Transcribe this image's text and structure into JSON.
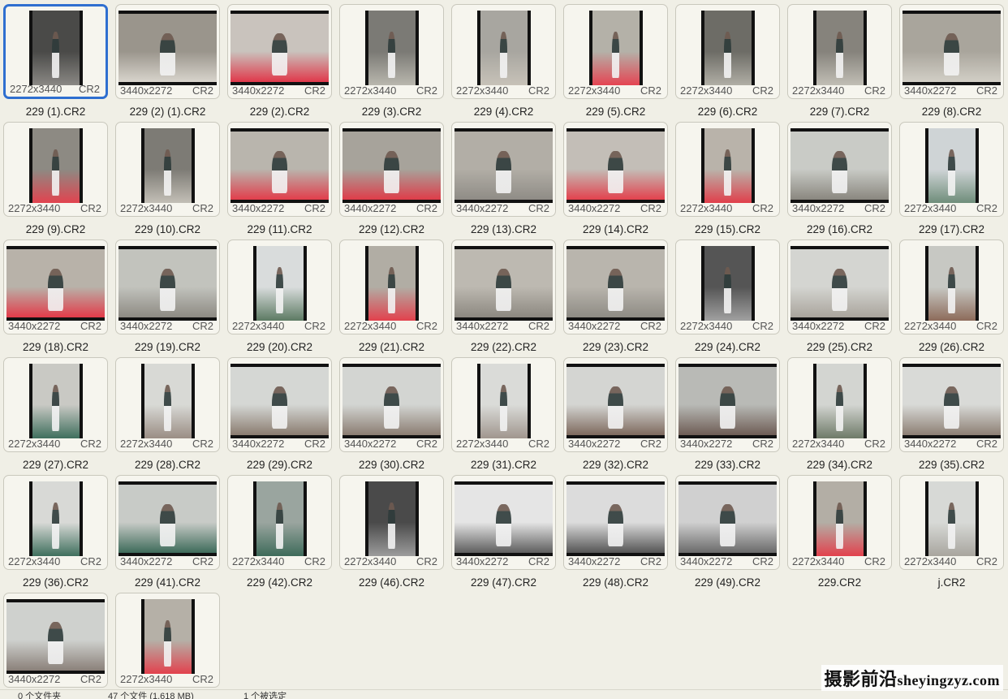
{
  "files": [
    {
      "name": "229 (1).CR2",
      "res": "2272x3440",
      "ext": "CR2",
      "selected": true,
      "tone": [
        "#4a4a48",
        "#8a8884"
      ]
    },
    {
      "name": "229 (2) (1).CR2",
      "res": "3440x2272",
      "ext": "CR2",
      "tone": [
        "#9a958c",
        "#d8d4cc"
      ]
    },
    {
      "name": "229 (2).CR2",
      "res": "3440x2272",
      "ext": "CR2",
      "tone": [
        "#c9c3bd",
        "#e0384a"
      ]
    },
    {
      "name": "229 (3).CR2",
      "res": "2272x3440",
      "ext": "CR2",
      "tone": [
        "#7b7a75",
        "#b9b7ae"
      ]
    },
    {
      "name": "229 (4).CR2",
      "res": "2272x3440",
      "ext": "CR2",
      "tone": [
        "#a8a6a0",
        "#c7c2b8"
      ]
    },
    {
      "name": "229 (5).CR2",
      "res": "2272x3440",
      "ext": "CR2",
      "tone": [
        "#b4b1a8",
        "#e54452"
      ]
    },
    {
      "name": "229 (6).CR2",
      "res": "2272x3440",
      "ext": "CR2",
      "tone": [
        "#6d6c66",
        "#b0aea5"
      ]
    },
    {
      "name": "229 (7).CR2",
      "res": "2272x3440",
      "ext": "CR2",
      "tone": [
        "#86837c",
        "#c1beb5"
      ]
    },
    {
      "name": "229 (8).CR2",
      "res": "3440x2272",
      "ext": "CR2",
      "tone": [
        "#a9a59c",
        "#d2cfc6"
      ]
    },
    {
      "name": "229 (9).CR2",
      "res": "2272x3440",
      "ext": "CR2",
      "tone": [
        "#8d8a83",
        "#e2434f"
      ]
    },
    {
      "name": "229 (10).CR2",
      "res": "2272x3440",
      "ext": "CR2",
      "tone": [
        "#7d7b75",
        "#c3bfb6"
      ]
    },
    {
      "name": "229 (11).CR2",
      "res": "3440x2272",
      "ext": "CR2",
      "tone": [
        "#b9b5ad",
        "#e23d4b"
      ]
    },
    {
      "name": "229 (12).CR2",
      "res": "3440x2272",
      "ext": "CR2",
      "tone": [
        "#a7a39b",
        "#df3c49"
      ]
    },
    {
      "name": "229 (13).CR2",
      "res": "3440x2272",
      "ext": "CR2",
      "tone": [
        "#b2aea6",
        "#8f8c86"
      ]
    },
    {
      "name": "229 (14).CR2",
      "res": "3440x2272",
      "ext": "CR2",
      "tone": [
        "#c3beb7",
        "#e3414d"
      ]
    },
    {
      "name": "229 (15).CR2",
      "res": "2272x3440",
      "ext": "CR2",
      "tone": [
        "#b9b3aa",
        "#e03f4b"
      ]
    },
    {
      "name": "229 (16).CR2",
      "res": "3440x2272",
      "ext": "CR2",
      "tone": [
        "#c9cbc6",
        "#8a877f"
      ]
    },
    {
      "name": "229 (17).CR2",
      "res": "2272x3440",
      "ext": "CR2",
      "tone": [
        "#cfd4d6",
        "#6f8d7a"
      ]
    },
    {
      "name": "229 (18).CR2",
      "res": "3440x2272",
      "ext": "CR2",
      "tone": [
        "#b8b2a9",
        "#e33b49"
      ]
    },
    {
      "name": "229 (19).CR2",
      "res": "3440x2272",
      "ext": "CR2",
      "tone": [
        "#c2c3bd",
        "#8d8a83"
      ]
    },
    {
      "name": "229 (20).CR2",
      "res": "2272x3440",
      "ext": "CR2",
      "tone": [
        "#d9dcdc",
        "#5c7a63"
      ]
    },
    {
      "name": "229 (21).CR2",
      "res": "2272x3440",
      "ext": "CR2",
      "tone": [
        "#b1ada4",
        "#e2414d"
      ]
    },
    {
      "name": "229 (22).CR2",
      "res": "3440x2272",
      "ext": "CR2",
      "tone": [
        "#bdb9b1",
        "#8c8880"
      ]
    },
    {
      "name": "229 (23).CR2",
      "res": "3440x2272",
      "ext": "CR2",
      "tone": [
        "#b9b5ad",
        "#8e8b84"
      ]
    },
    {
      "name": "229 (24).CR2",
      "res": "2272x3440",
      "ext": "CR2",
      "tone": [
        "#555555",
        "#a0a0a0"
      ]
    },
    {
      "name": "229 (25).CR2",
      "res": "3440x2272",
      "ext": "CR2",
      "tone": [
        "#d4d5d1",
        "#a9a49c"
      ]
    },
    {
      "name": "229 (26).CR2",
      "res": "2272x3440",
      "ext": "CR2",
      "tone": [
        "#c7c8c3",
        "#8d6b5a"
      ]
    },
    {
      "name": "229 (27).CR2",
      "res": "2272x3440",
      "ext": "CR2",
      "tone": [
        "#c9c9c4",
        "#3f6f5d"
      ]
    },
    {
      "name": "229 (28).CR2",
      "res": "2272x3440",
      "ext": "CR2",
      "tone": [
        "#d8d9d5",
        "#9a8d84"
      ]
    },
    {
      "name": "229 (29).CR2",
      "res": "3440x2272",
      "ext": "CR2",
      "tone": [
        "#d5d7d4",
        "#8a7c70"
      ]
    },
    {
      "name": "229 (30).CR2",
      "res": "3440x2272",
      "ext": "CR2",
      "tone": [
        "#d3d5d2",
        "#8b7d72"
      ]
    },
    {
      "name": "229 (31).CR2",
      "res": "2272x3440",
      "ext": "CR2",
      "tone": [
        "#dadbd8",
        "#a0968e"
      ]
    },
    {
      "name": "229 (32).CR2",
      "res": "3440x2272",
      "ext": "CR2",
      "tone": [
        "#d4d5d2",
        "#7e6a5e"
      ]
    },
    {
      "name": "229 (33).CR2",
      "res": "3440x2272",
      "ext": "CR2",
      "tone": [
        "#b9bab6",
        "#6e5d55"
      ]
    },
    {
      "name": "229 (34).CR2",
      "res": "2272x3440",
      "ext": "CR2",
      "tone": [
        "#d3d5d1",
        "#6e7a68"
      ]
    },
    {
      "name": "229 (35).CR2",
      "res": "3440x2272",
      "ext": "CR2",
      "tone": [
        "#d9dad7",
        "#8d7f74"
      ]
    },
    {
      "name": "229 (36).CR2",
      "res": "2272x3440",
      "ext": "CR2",
      "tone": [
        "#d8d9d6",
        "#3f6f5d"
      ]
    },
    {
      "name": "229 (41).CR2",
      "res": "3440x2272",
      "ext": "CR2",
      "tone": [
        "#c8cbc7",
        "#3e6b5a"
      ]
    },
    {
      "name": "229 (42).CR2",
      "res": "2272x3440",
      "ext": "CR2",
      "tone": [
        "#9aa59f",
        "#3e6b5a"
      ]
    },
    {
      "name": "229 (46).CR2",
      "res": "2272x3440",
      "ext": "CR2",
      "tone": [
        "#4a4a4a",
        "#9c9c9c"
      ]
    },
    {
      "name": "229 (47).CR2",
      "res": "3440x2272",
      "ext": "CR2",
      "tone": [
        "#e5e5e5",
        "#5e5e5e"
      ]
    },
    {
      "name": "229 (48).CR2",
      "res": "3440x2272",
      "ext": "CR2",
      "tone": [
        "#dcdcdc",
        "#555555"
      ]
    },
    {
      "name": "229 (49).CR2",
      "res": "3440x2272",
      "ext": "CR2",
      "tone": [
        "#d0d0d0",
        "#6a6a6a"
      ]
    },
    {
      "name": "229.CR2",
      "res": "2272x3440",
      "ext": "CR2",
      "tone": [
        "#b3aea5",
        "#e2414d"
      ]
    },
    {
      "name": "j.CR2",
      "res": "2272x3440",
      "ext": "CR2",
      "tone": [
        "#d7d9d6",
        "#a8a59e"
      ]
    },
    {
      "name": "",
      "res": "3440x2272",
      "ext": "CR2",
      "tone": [
        "#cfd1ce",
        "#8a8079"
      ]
    },
    {
      "name": "",
      "res": "2272x3440",
      "ext": "CR2",
      "tone": [
        "#b5b0a7",
        "#e2414d"
      ]
    }
  ],
  "statusbar": {
    "folders": "0 个文件夹",
    "files": "47 个文件 (1,618 MB)",
    "selected": "1 个被选定"
  },
  "watermark": {
    "cn": "摄影前沿",
    "en": "sheyingzyz.com"
  }
}
